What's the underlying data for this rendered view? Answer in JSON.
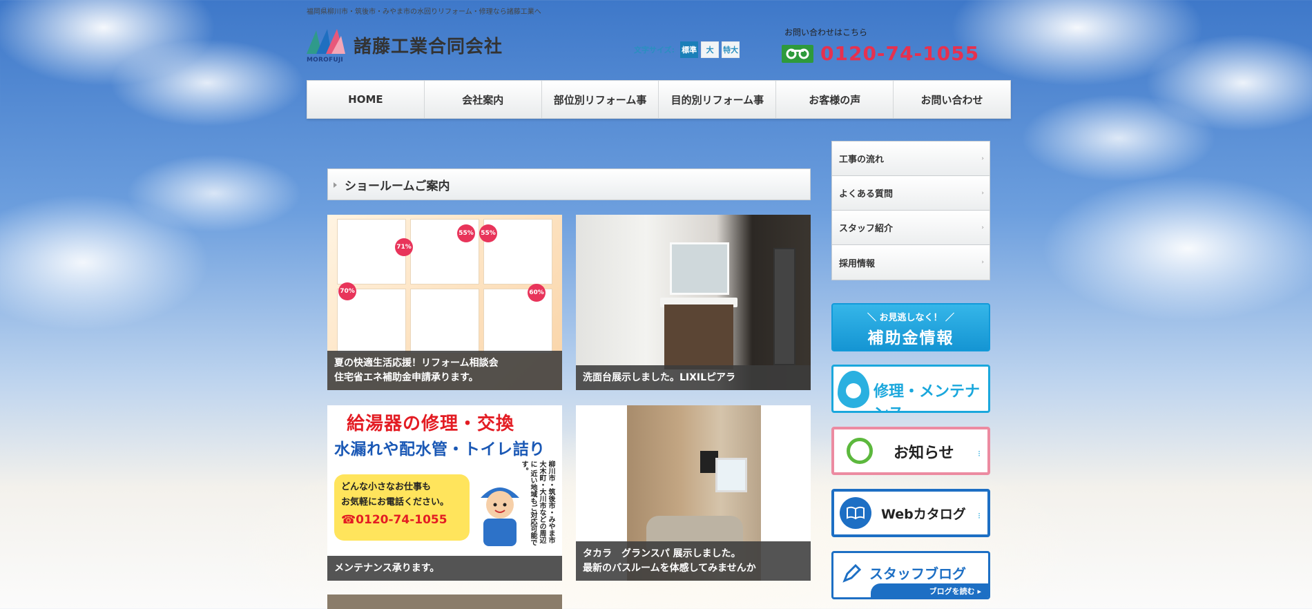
{
  "header": {
    "tagline": "福岡県柳川市・筑後市・みやま市の水回りリフォーム・修理なら諸藤工業へ",
    "logo_caption": "MOROFUJI",
    "company_name": "諸藤工業合同会社",
    "font_size": {
      "label": "文字サイズ:",
      "options": [
        "標準",
        "大",
        "特大"
      ],
      "selected": "標準"
    },
    "contact": {
      "label": "お問い合わせはこちら",
      "phone": "0120-74-1055"
    }
  },
  "nav": {
    "items": [
      "HOME",
      "会社案内",
      "部位別リフォーム事",
      "目的別リフォーム事",
      "お客様の声",
      "お問い合わせ"
    ]
  },
  "main": {
    "section_title": "ショールームご案内",
    "cards": [
      {
        "caption_line1": "夏の快適生活応援！リフォーム相談会",
        "caption_line2": "住宅省エネ補助金申請承ります。"
      },
      {
        "caption_line1": "洗面台展示しました。LIXILピアラ",
        "caption_line2": ""
      },
      {
        "caption_line1": "メンテナンス承ります。",
        "caption_line2": ""
      },
      {
        "caption_line1": "タカラ　グランスパ 展示しました。",
        "caption_line2": "最新のバスルームを体感してみませんか"
      }
    ],
    "flyer_badges": [
      "55%",
      "55%",
      "71%",
      "70%",
      "60%"
    ],
    "repair_ad": {
      "line1": "給湯器の修理・交換",
      "line2": "水漏れや配水管・トイレ詰り",
      "bubble_line1": "どんな小さなお仕事も",
      "bubble_line2": "お気軽にお電話ください。",
      "bubble_tel": "☎0120-74-1055",
      "vertical": "柳川市・筑後市・みやま市 大木町・大川市などの周辺に 近い地域もご対応可能です。"
    }
  },
  "sidebar": {
    "items": [
      "工事の流れ",
      "よくある質問",
      "スタッフ紹介",
      "採用情報"
    ],
    "banners": {
      "subsidy_small": "＼ お見逃しなく！ ／",
      "subsidy_big": "補助金情報",
      "repair": "修理・メンテナンス",
      "news": "お知らせ",
      "catalog": "Webカタログ",
      "blog": "スタッフブログ",
      "blog_footer": "ブログを読む ▸"
    }
  },
  "colors": {
    "accent_blue": "#1a7fb8",
    "phone_red": "#e6314f",
    "freedial_green": "#2e9a3c"
  }
}
